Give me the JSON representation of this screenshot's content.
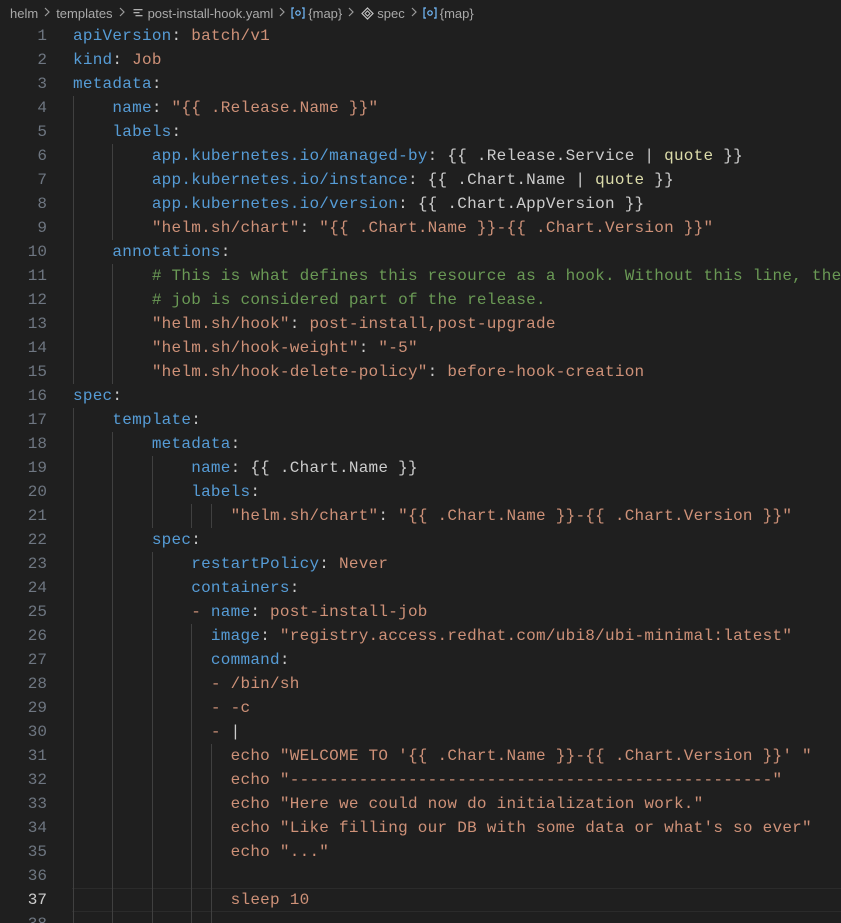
{
  "breadcrumb": {
    "items": [
      {
        "label": "helm",
        "icon": null
      },
      {
        "label": "templates",
        "icon": null
      },
      {
        "label": "post-install-hook.yaml",
        "icon": "yaml-file-icon"
      },
      {
        "label": "{map}",
        "icon": "map-symbol-icon"
      },
      {
        "label": "spec",
        "icon": "property-symbol-icon"
      },
      {
        "label": "{map}",
        "icon": "map-symbol-icon"
      }
    ],
    "separator": "chevron-right-icon"
  },
  "editor": {
    "current_line": 37,
    "colors": {
      "background": "#1f1f1f",
      "key": "#569cd6",
      "string": "#ce9178",
      "comment": "#6a9955",
      "function": "#dcdcaa",
      "text": "#cccccc",
      "line_number": "#6e7681"
    },
    "lines": [
      {
        "n": "1",
        "tokens": [
          [
            "k",
            "apiVersion"
          ],
          [
            "p",
            ": "
          ],
          [
            "s",
            "batch/v1"
          ]
        ]
      },
      {
        "n": "2",
        "tokens": [
          [
            "k",
            "kind"
          ],
          [
            "p",
            ": "
          ],
          [
            "s",
            "Job"
          ]
        ]
      },
      {
        "n": "3",
        "tokens": [
          [
            "k",
            "metadata"
          ],
          [
            "p",
            ":"
          ]
        ]
      },
      {
        "n": "4",
        "tokens": [
          [
            "p",
            "    "
          ],
          [
            "k",
            "name"
          ],
          [
            "p",
            ": "
          ],
          [
            "s",
            "\"{{ .Release.Name }}\""
          ]
        ]
      },
      {
        "n": "5",
        "tokens": [
          [
            "p",
            "    "
          ],
          [
            "k",
            "labels"
          ],
          [
            "p",
            ":"
          ]
        ]
      },
      {
        "n": "6",
        "tokens": [
          [
            "p",
            "        "
          ],
          [
            "k",
            "app.kubernetes.io/managed-by"
          ],
          [
            "p",
            ": {{ .Release.Service | "
          ],
          [
            "f",
            "quote"
          ],
          [
            "p",
            " }}"
          ]
        ]
      },
      {
        "n": "7",
        "tokens": [
          [
            "p",
            "        "
          ],
          [
            "k",
            "app.kubernetes.io/instance"
          ],
          [
            "p",
            ": {{ .Chart.Name | "
          ],
          [
            "f",
            "quote"
          ],
          [
            "p",
            " }}"
          ]
        ]
      },
      {
        "n": "8",
        "tokens": [
          [
            "p",
            "        "
          ],
          [
            "k",
            "app.kubernetes.io/version"
          ],
          [
            "p",
            ": {{ .Chart.AppVersion }}"
          ]
        ]
      },
      {
        "n": "9",
        "tokens": [
          [
            "p",
            "        "
          ],
          [
            "s",
            "\"helm.sh/chart\""
          ],
          [
            "p",
            ": "
          ],
          [
            "s",
            "\"{{ .Chart.Name }}-{{ .Chart.Version }}\""
          ]
        ]
      },
      {
        "n": "10",
        "tokens": [
          [
            "p",
            "    "
          ],
          [
            "k",
            "annotations"
          ],
          [
            "p",
            ":"
          ]
        ]
      },
      {
        "n": "11",
        "tokens": [
          [
            "p",
            "        "
          ],
          [
            "c",
            "# This is what defines this resource as a hook. Without this line, the"
          ]
        ]
      },
      {
        "n": "12",
        "tokens": [
          [
            "p",
            "        "
          ],
          [
            "c",
            "# job is considered part of the release."
          ]
        ]
      },
      {
        "n": "13",
        "tokens": [
          [
            "p",
            "        "
          ],
          [
            "s",
            "\"helm.sh/hook\""
          ],
          [
            "p",
            ": "
          ],
          [
            "s",
            "post-install,post-upgrade"
          ]
        ]
      },
      {
        "n": "14",
        "tokens": [
          [
            "p",
            "        "
          ],
          [
            "s",
            "\"helm.sh/hook-weight\""
          ],
          [
            "p",
            ": "
          ],
          [
            "s",
            "\"-5\""
          ]
        ]
      },
      {
        "n": "15",
        "tokens": [
          [
            "p",
            "        "
          ],
          [
            "s",
            "\"helm.sh/hook-delete-policy\""
          ],
          [
            "p",
            ": "
          ],
          [
            "s",
            "before-hook-creation"
          ]
        ]
      },
      {
        "n": "16",
        "tokens": [
          [
            "k",
            "spec"
          ],
          [
            "p",
            ":"
          ]
        ]
      },
      {
        "n": "17",
        "tokens": [
          [
            "p",
            "    "
          ],
          [
            "k",
            "template"
          ],
          [
            "p",
            ":"
          ]
        ]
      },
      {
        "n": "18",
        "tokens": [
          [
            "p",
            "        "
          ],
          [
            "k",
            "metadata"
          ],
          [
            "p",
            ":"
          ]
        ]
      },
      {
        "n": "19",
        "tokens": [
          [
            "p",
            "            "
          ],
          [
            "k",
            "name"
          ],
          [
            "p",
            ": {{ .Chart.Name }}"
          ]
        ]
      },
      {
        "n": "20",
        "tokens": [
          [
            "p",
            "            "
          ],
          [
            "k",
            "labels"
          ],
          [
            "p",
            ":"
          ]
        ]
      },
      {
        "n": "21",
        "tokens": [
          [
            "p",
            "                "
          ],
          [
            "s",
            "\"helm.sh/chart\""
          ],
          [
            "p",
            ": "
          ],
          [
            "s",
            "\"{{ .Chart.Name }}-{{ .Chart.Version }}\""
          ]
        ]
      },
      {
        "n": "22",
        "tokens": [
          [
            "p",
            "        "
          ],
          [
            "k",
            "spec"
          ],
          [
            "p",
            ":"
          ]
        ]
      },
      {
        "n": "23",
        "tokens": [
          [
            "p",
            "            "
          ],
          [
            "k",
            "restartPolicy"
          ],
          [
            "p",
            ": "
          ],
          [
            "s",
            "Never"
          ]
        ]
      },
      {
        "n": "24",
        "tokens": [
          [
            "p",
            "            "
          ],
          [
            "k",
            "containers"
          ],
          [
            "p",
            ":"
          ]
        ]
      },
      {
        "n": "25",
        "tokens": [
          [
            "p",
            "            "
          ],
          [
            "s",
            "- "
          ],
          [
            "k",
            "name"
          ],
          [
            "p",
            ": "
          ],
          [
            "s",
            "post-install-job"
          ]
        ]
      },
      {
        "n": "26",
        "tokens": [
          [
            "p",
            "              "
          ],
          [
            "k",
            "image"
          ],
          [
            "p",
            ": "
          ],
          [
            "s",
            "\"registry.access.redhat.com/ubi8/ubi-minimal:latest\""
          ]
        ]
      },
      {
        "n": "27",
        "tokens": [
          [
            "p",
            "              "
          ],
          [
            "k",
            "command"
          ],
          [
            "p",
            ":"
          ]
        ]
      },
      {
        "n": "28",
        "tokens": [
          [
            "p",
            "              "
          ],
          [
            "s",
            "- /bin/sh"
          ]
        ]
      },
      {
        "n": "29",
        "tokens": [
          [
            "p",
            "              "
          ],
          [
            "s",
            "- -c"
          ]
        ]
      },
      {
        "n": "30",
        "tokens": [
          [
            "p",
            "              "
          ],
          [
            "s",
            "- "
          ],
          [
            "p",
            "|"
          ]
        ]
      },
      {
        "n": "31",
        "tokens": [
          [
            "p",
            "                "
          ],
          [
            "s",
            "echo \"WELCOME TO '{{ .Chart.Name }}-{{ .Chart.Version }}' \""
          ]
        ]
      },
      {
        "n": "32",
        "tokens": [
          [
            "p",
            "                "
          ],
          [
            "s",
            "echo \"-------------------------------------------------\""
          ]
        ]
      },
      {
        "n": "33",
        "tokens": [
          [
            "p",
            "                "
          ],
          [
            "s",
            "echo \"Here we could now do initialization work.\""
          ]
        ]
      },
      {
        "n": "34",
        "tokens": [
          [
            "p",
            "                "
          ],
          [
            "s",
            "echo \"Like filling our DB with some data or what's so ever\""
          ]
        ]
      },
      {
        "n": "35",
        "tokens": [
          [
            "p",
            "                "
          ],
          [
            "s",
            "echo \"...\""
          ]
        ]
      },
      {
        "n": "36",
        "tokens": []
      },
      {
        "n": "37",
        "tokens": [
          [
            "p",
            "                "
          ],
          [
            "s",
            "sleep 10"
          ]
        ]
      },
      {
        "n": "38",
        "tokens": []
      }
    ]
  }
}
